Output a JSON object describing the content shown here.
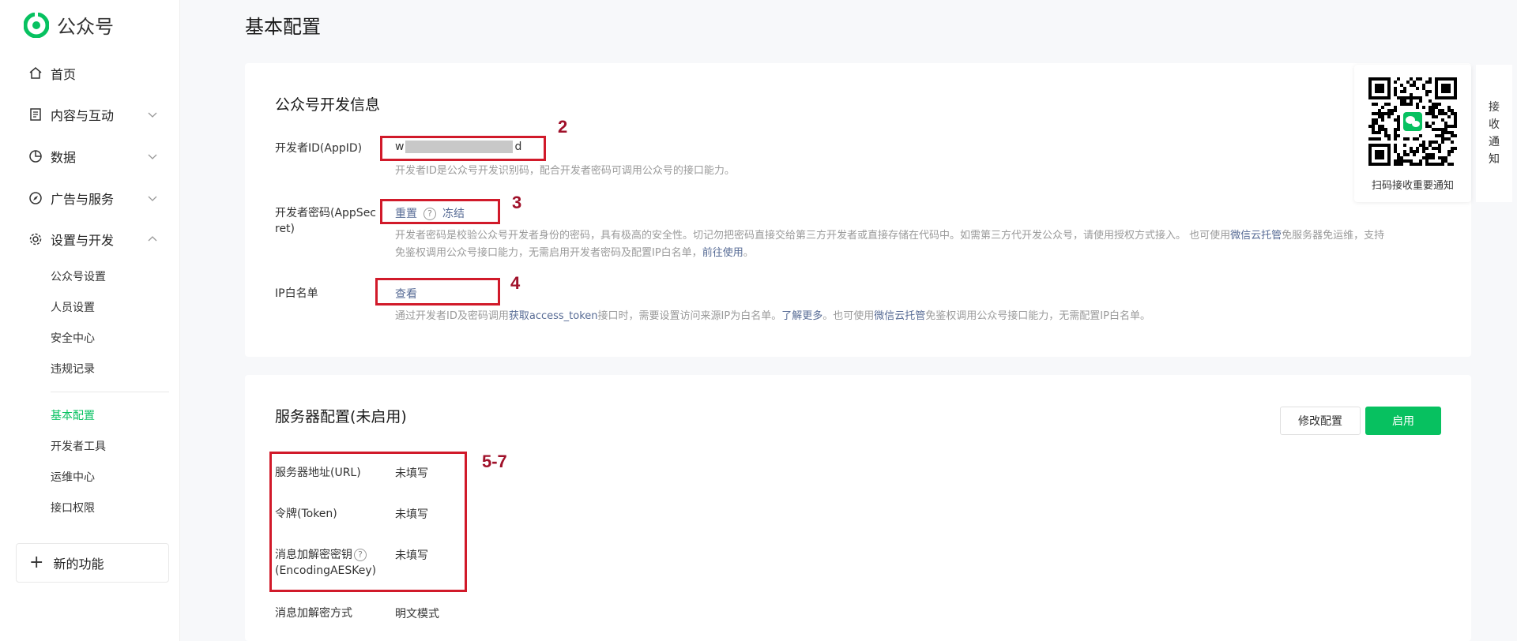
{
  "app": {
    "name": "公众号"
  },
  "sidebar": {
    "items": [
      {
        "label": "首页",
        "icon": "home-icon"
      },
      {
        "label": "内容与互动",
        "icon": "document-icon"
      },
      {
        "label": "数据",
        "icon": "pie-chart-icon"
      },
      {
        "label": "广告与服务",
        "icon": "compass-icon"
      },
      {
        "label": "设置与开发",
        "icon": "gear-icon"
      }
    ],
    "sub_items": [
      "公众号设置",
      "人员设置",
      "安全中心",
      "违规记录",
      "基本配置",
      "开发者工具",
      "运维中心",
      "接口权限"
    ],
    "active_sub": "基本配置",
    "new_features": "新的功能"
  },
  "page": {
    "title": "基本配置"
  },
  "dev_info": {
    "title": "公众号开发信息",
    "appid": {
      "label": "开发者ID(AppID)",
      "value_start": "w",
      "value_end": "d",
      "desc": "开发者ID是公众号开发识别码，配合开发者密码可调用公众号的接口能力。"
    },
    "secret": {
      "label_line1": "开发者密码(AppSec",
      "label_line2": "ret)",
      "reset": "重置",
      "help": "?",
      "freeze": "冻结",
      "desc_part1": "开发者密码是校验公众号开发者身份的密码，具有极高的安全性。切记勿把密码直接交给第三方开发者或直接存储在代码中。如需第三方代开发公众号，请使用授权方式接入。 也可使用",
      "desc_link1": "微信云托管",
      "desc_part2": "免服务器免运维，支持",
      "desc_part3": "免鉴权调用公众号接口能力，无需启用开发者密码及配置IP白名单，",
      "desc_link2": "前往使用",
      "desc_part4": "。"
    },
    "ip": {
      "label": "IP白名单",
      "view": "查看",
      "desc_part1": "通过开发者ID及密码调用",
      "desc_link1": "获取access_token",
      "desc_part2": "接口时，需要设置访问来源IP为白名单。",
      "desc_link2": "了解更多",
      "desc_part3": "。也可使用",
      "desc_link3": "微信云托管",
      "desc_part4": "免鉴权调用公众号接口能力，无需配置IP白名单。"
    }
  },
  "server": {
    "title": "服务器配置(未启用)",
    "modify_button": "修改配置",
    "enable_button": "启用",
    "rows": [
      {
        "label": "服务器地址(URL)",
        "value": "未填写"
      },
      {
        "label": "令牌(Token)",
        "value": "未填写"
      },
      {
        "label": "消息加解密密钥",
        "label2": "(EncodingAESKey)",
        "value": "未填写"
      },
      {
        "label": "消息加解密方式",
        "value": "明文模式"
      }
    ]
  },
  "qr": {
    "caption": "扫码接收重要通知"
  },
  "notify_tab": [
    "接",
    "收",
    "通",
    "知"
  ],
  "annotations": [
    "2",
    "3",
    "4",
    "5-7"
  ],
  "colors": {
    "accent": "#07c160",
    "link": "#576b95",
    "annotation_red": "#d11a2a"
  }
}
